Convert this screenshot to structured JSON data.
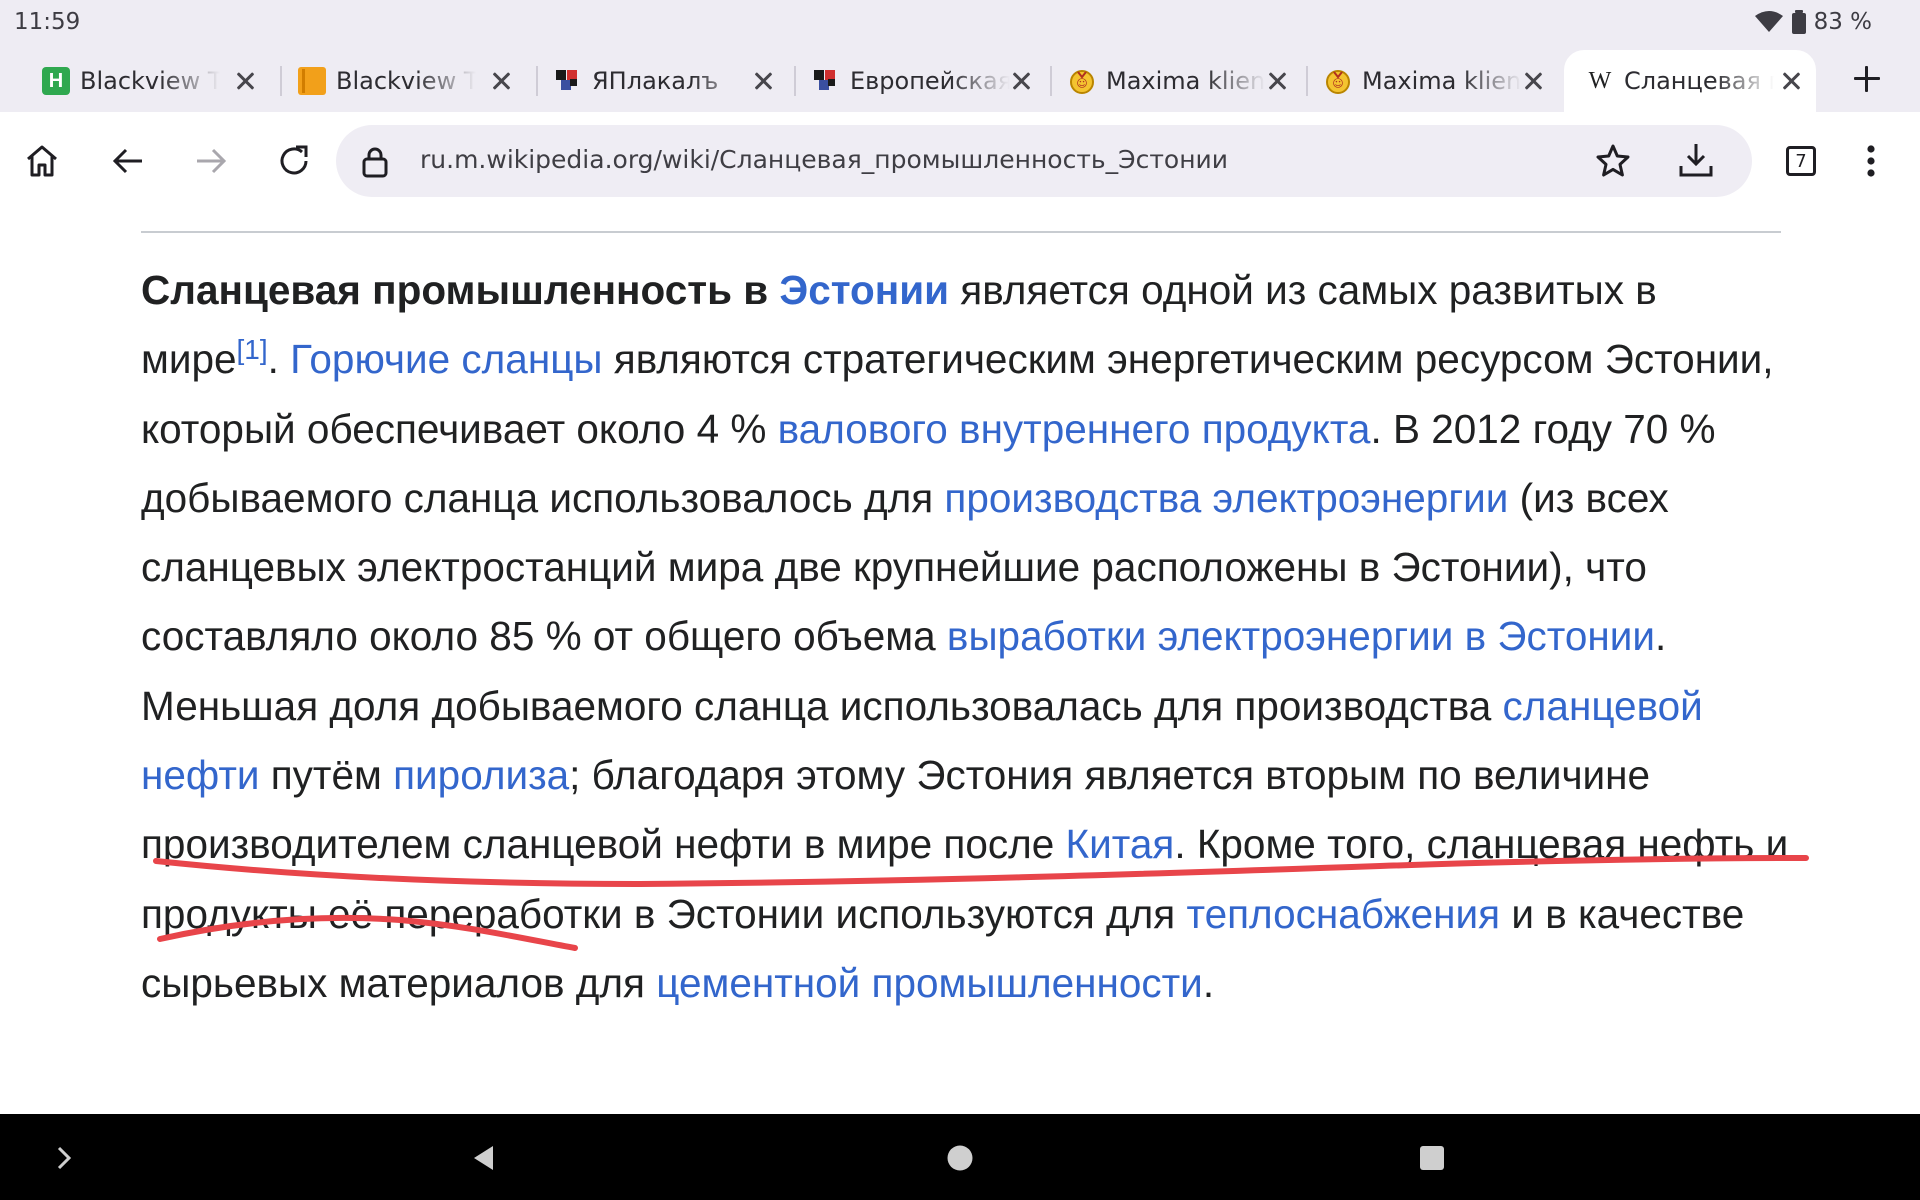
{
  "status": {
    "time": "11:59",
    "battery_text": "83 %"
  },
  "tabs": [
    {
      "title": "Blackview Tab",
      "favicon": "h-favicon"
    },
    {
      "title": "Blackview Tab",
      "favicon": "book-favicon"
    },
    {
      "title": "ЯПлакалъ",
      "favicon": "yaplakal-favicon"
    },
    {
      "title": "Европейская",
      "favicon": "yaplakal-favicon"
    },
    {
      "title": "Maxima klient",
      "favicon": "maxima-favicon"
    },
    {
      "title": "Maxima klient",
      "favicon": "maxima-favicon"
    },
    {
      "title": "Сланцевая п",
      "favicon": "wikipedia-favicon",
      "active": true
    }
  ],
  "tab_strip": {
    "new_tab_icon": "plus-icon"
  },
  "toolbar": {
    "url": "ru.m.wikipedia.org/wiki/Сланцевая_промышленность_Эстонии",
    "tab_count": "7",
    "icons": [
      "home-icon",
      "back-arrow-icon",
      "forward-arrow-icon",
      "reload-icon",
      "lock-icon",
      "star-icon",
      "download-icon",
      "tab-switcher-icon",
      "more-vert-icon"
    ]
  },
  "article": {
    "p1_bold": "Сланцевая промышленность в",
    "p1_link_estonia": "Эстонии",
    "p1_t1": " является одной из самых развитых в мире",
    "p1_ref": "[1]",
    "p1_t2": ". ",
    "link_oil_shale": "Горючие сланцы",
    "t3": " являются стратегическим энергетическим ресурсом Эстонии, который обеспечивает около 4 % ",
    "link_gdp": "валового внутреннего продукта",
    "t4": ". В 2012 году 70 % добываемого сланца использовалось для ",
    "link_power_production": "производства электроэнергии",
    "t5": " (из всех сланцевых электростанций мира две крупнейшие расположены в Эстонии), что составляло около 85 % от общего объема ",
    "link_power_generation": "выработки электроэнергии в Эстонии",
    "t6": ". Меньшая доля добываемого сланца использовалась для производства ",
    "link_shale_oil": "сланцевой нефти",
    "t7": " путём ",
    "link_pyrolysis": "пиролиза",
    "t8": "; благодаря этому Эстония является вторым по величине производителем сланцевой нефти в мире после ",
    "link_china": "Китая",
    "t9": ". Кроме того, сланцевая нефть и продукты её переработки в Эстонии используются для ",
    "link_heat": "теплоснабжения",
    "t10": " и в качестве сырьевых материалов для ",
    "link_cement": "цементной промышленности",
    "t11": "."
  },
  "annotation": {
    "color": "#e8454a",
    "kind": "hand-drawn-underline"
  },
  "nav_bar": {
    "icons": [
      "expand-chevron-icon",
      "back-triangle-icon",
      "home-circle-icon",
      "recents-square-icon"
    ]
  },
  "colors": {
    "link": "#3366cc",
    "text": "#202122",
    "chrome_bg": "#eeecf3"
  }
}
